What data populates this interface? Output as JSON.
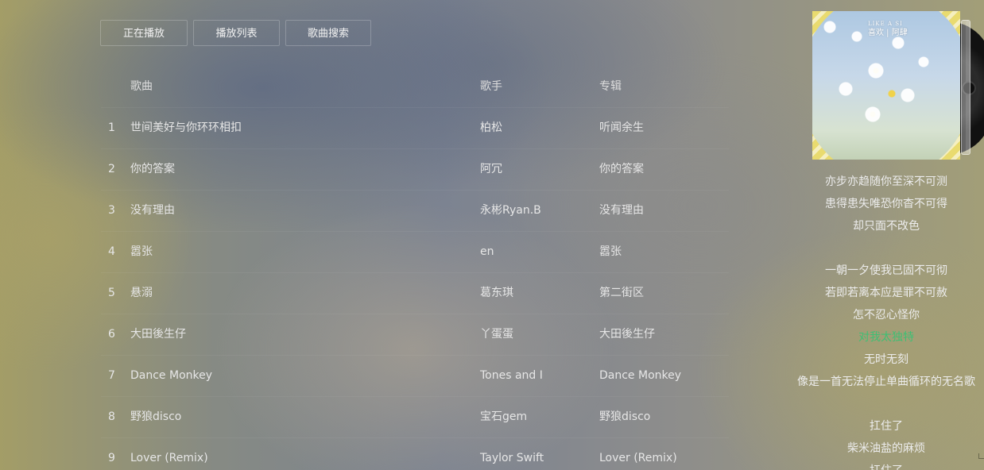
{
  "tabs": [
    "正在播放",
    "播放列表",
    "歌曲搜索"
  ],
  "table": {
    "headers": {
      "title": "歌曲",
      "artist": "歌手",
      "album": "专辑"
    },
    "rows": [
      {
        "num": "1",
        "title": "世间美好与你环环相扣",
        "artist": "柏松",
        "album": "听闻余生"
      },
      {
        "num": "2",
        "title": "你的答案",
        "artist": "阿冗",
        "album": "你的答案"
      },
      {
        "num": "3",
        "title": "没有理由",
        "artist": "永彬Ryan.B",
        "album": "没有理由"
      },
      {
        "num": "4",
        "title": "嚣张",
        "artist": "en",
        "album": "嚣张"
      },
      {
        "num": "5",
        "title": "悬溺",
        "artist": "葛东琪",
        "album": "第二街区"
      },
      {
        "num": "6",
        "title": "大田後生仔",
        "artist": "丫蛋蛋",
        "album": "大田後生仔"
      },
      {
        "num": "7",
        "title": "Dance Monkey",
        "artist": "Tones and I",
        "album": "Dance Monkey"
      },
      {
        "num": "8",
        "title": "野狼disco",
        "artist": "宝石gem",
        "album": "野狼disco"
      },
      {
        "num": "9",
        "title": "Lover (Remix)",
        "artist": "Taylor Swift",
        "album": "Lover (Remix)"
      }
    ]
  },
  "album_art": {
    "tag_top": "LIKE    A SI",
    "tag_title": "喜欢 | 阿肆"
  },
  "lyrics": {
    "lines": [
      "亦步亦趋随你至深不可测",
      "患得患失唯恐你杳不可得",
      "却只面不改色",
      "",
      "一朝一夕使我已固不可彻",
      "若即若离本应是罪不可赦",
      "怎不忍心怪你",
      "对我太独特",
      "无时无刻",
      "像是一首无法停止单曲循环的无名歌",
      "",
      "扛住了",
      "柴米油盐的麻烦",
      "扛住了"
    ],
    "active_index": 7,
    "active_color": "#3fbf74"
  }
}
